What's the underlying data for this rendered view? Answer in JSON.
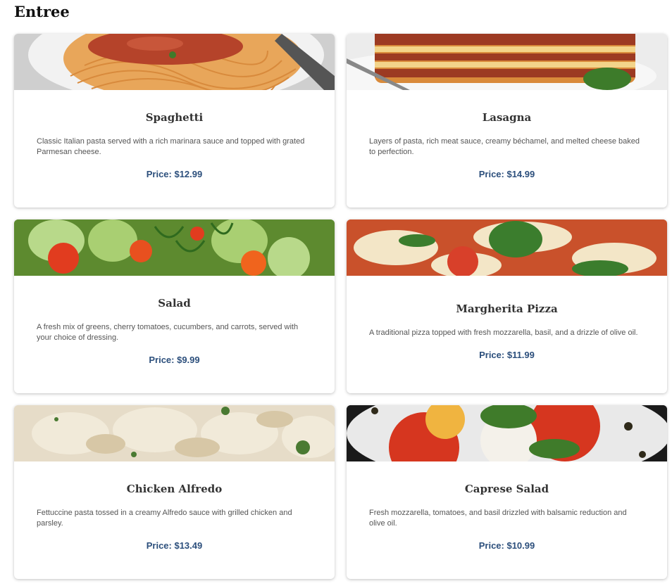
{
  "section": {
    "title": "Entree"
  },
  "dishes": [
    {
      "name": "Spaghetti",
      "description": "Classic Italian pasta served with a rich marinara sauce and topped with grated Parmesan cheese.",
      "price": "Price: $12.99",
      "image": "spaghetti-photo"
    },
    {
      "name": "Lasagna",
      "description": "Layers of pasta, rich meat sauce, creamy béchamel, and melted cheese baked to perfection.",
      "price": "Price: $14.99",
      "image": "lasagna-photo"
    },
    {
      "name": "Salad",
      "description": "A fresh mix of greens, cherry tomatoes, cucumbers, and carrots, served with your choice of dressing.",
      "price": "Price: $9.99",
      "image": "salad-photo"
    },
    {
      "name": "Margherita Pizza",
      "description": "A traditional pizza topped with fresh mozzarella, basil, and a drizzle of olive oil.",
      "price": "Price: $11.99",
      "image": "pizza-photo"
    },
    {
      "name": "Chicken Alfredo",
      "description": "Fettuccine pasta tossed in a creamy Alfredo sauce with grilled chicken and parsley.",
      "price": "Price: $13.49",
      "image": "chicken-alfredo-photo"
    },
    {
      "name": "Caprese Salad",
      "description": "Fresh mozzarella, tomatoes, and basil drizzled with balsamic reduction and olive oil.",
      "price": "Price: $10.99",
      "image": "caprese-salad-photo"
    }
  ],
  "colors": {
    "price": "#2c4f7c",
    "title": "#111111",
    "text": "#555555"
  }
}
